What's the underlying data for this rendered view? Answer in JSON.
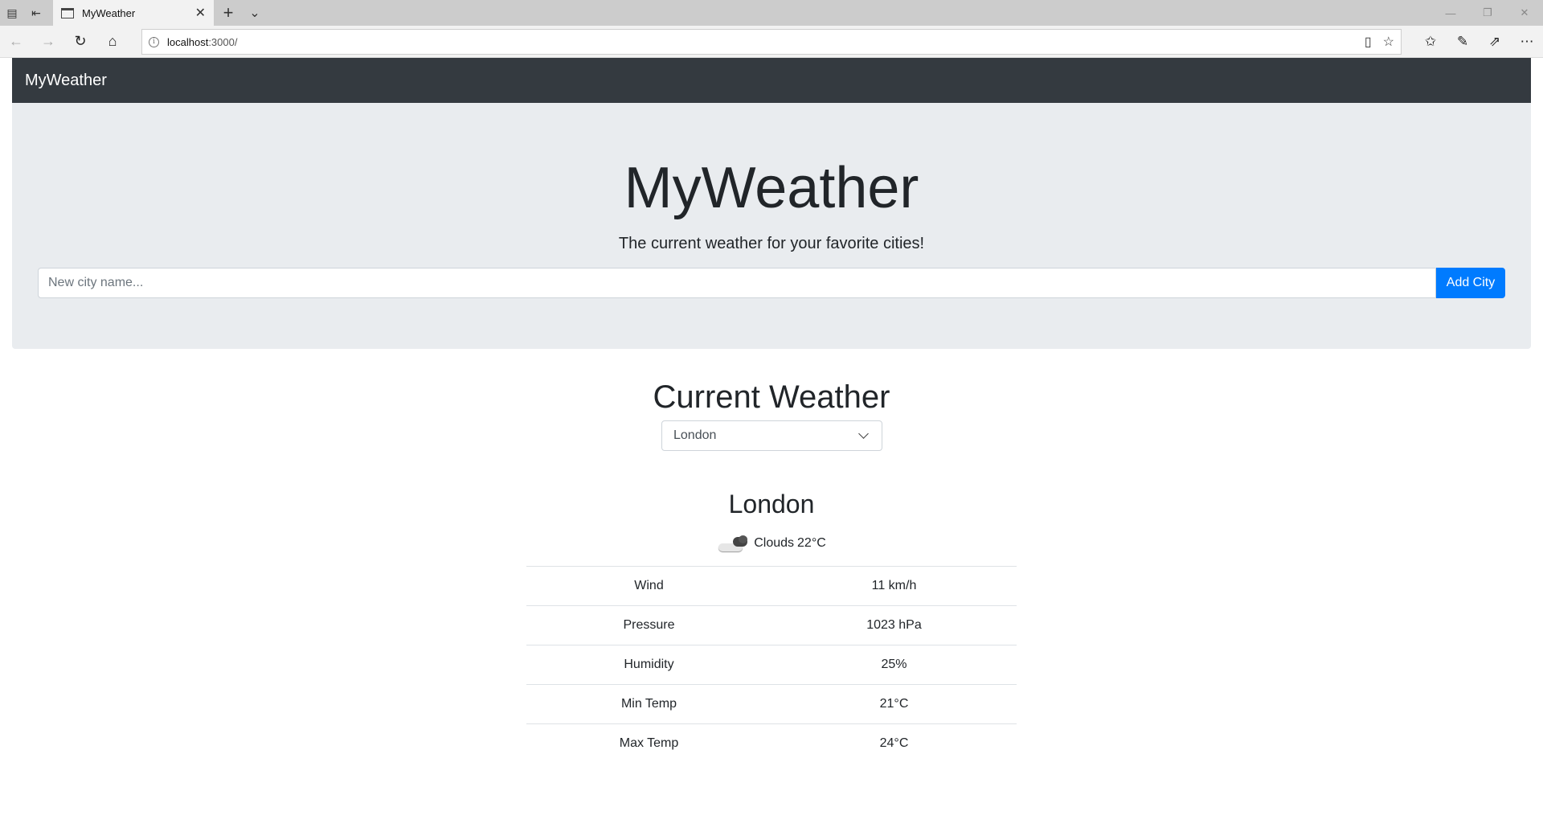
{
  "browser": {
    "tab_title": "MyWeather",
    "url_host": "localhost",
    "url_path": ":3000/"
  },
  "navbar": {
    "brand": "MyWeather"
  },
  "hero": {
    "title": "MyWeather",
    "lead": "The current weather for your favorite cities!",
    "input_placeholder": "New city name...",
    "input_value": "",
    "add_button": "Add City"
  },
  "weather": {
    "section_title": "Current Weather",
    "selected_city": "London",
    "city_name": "London",
    "condition": "Clouds",
    "temperature": "22°C",
    "icon": "clouds-icon",
    "rows": [
      {
        "label": "Wind",
        "value": "11 km/h"
      },
      {
        "label": "Pressure",
        "value": "1023 hPa"
      },
      {
        "label": "Humidity",
        "value": "25%"
      },
      {
        "label": "Min Temp",
        "value": "21°C"
      },
      {
        "label": "Max Temp",
        "value": "24°C"
      }
    ]
  },
  "colors": {
    "navbar_bg": "#343a40",
    "jumbotron_bg": "#e9ecef",
    "primary": "#007bff"
  }
}
